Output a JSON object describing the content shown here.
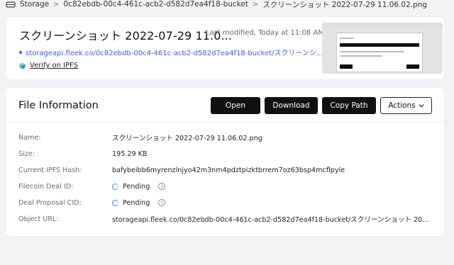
{
  "breadcrumb": {
    "root": "Storage",
    "bucket": "0c82ebdb-00c4-461c-acb2-d582d7ea4f18-bucket",
    "file": "スクリーンショット 2022-07-29 11.06.02.png",
    "separator": ">"
  },
  "file_header": {
    "title": "スクリーンショット 2022-07-29 11.0...",
    "last_modified": "Last modified, Today at 11:08 AM",
    "url": "storageapi.fleek.co/0c82ebdb-00c4-461c-acb2-d582d7ea4f18-bucket/スクリーンシ...",
    "verify_label": "Verify on IPFS",
    "accent_color": "#3b5fd6"
  },
  "file_info": {
    "title": "File Information",
    "buttons": {
      "open": "Open",
      "download": "Download",
      "copy_path": "Copy Path",
      "actions": "Actions"
    },
    "rows": [
      {
        "label": "Name:",
        "value": "スクリーンショット 2022-07-29 11.06.02.png"
      },
      {
        "label": "Size:",
        "value": "195.29 KB"
      },
      {
        "label": "Current IPFS Hash:",
        "value": "bafybeibb6myrenzlnjyo42m3nm4pdztpizktbrrem7oz63bsp4mcflpyle"
      },
      {
        "label": "Filecoin Deal ID:",
        "value": "Pending"
      },
      {
        "label": "Deal Proposal CID:",
        "value": "Pending"
      },
      {
        "label": "Object URL:",
        "value": "storageapi.fleek.co/0c82ebdb-00c4-461c-acb2-d582d7ea4f18-bucket/スクリーンショット 20..."
      }
    ],
    "pending_color": "#3b82f6",
    "info_icon": "i"
  }
}
